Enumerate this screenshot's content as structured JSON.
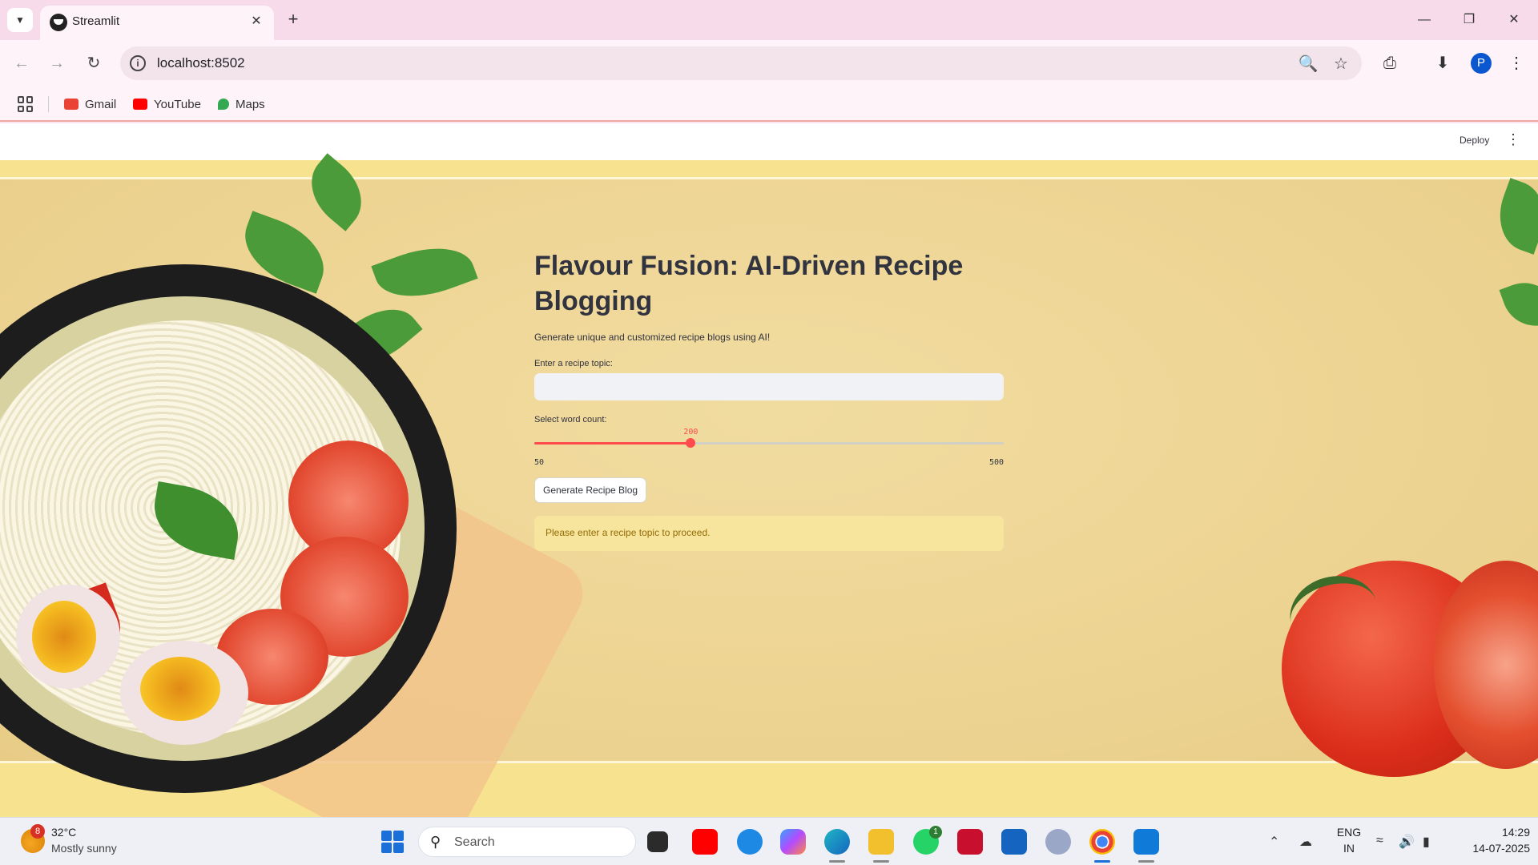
{
  "browser": {
    "tab_title": "Streamlit",
    "url": "localhost:8502",
    "bookmarks": [
      {
        "label": "Gmail",
        "icon": "gmail-icon",
        "color": "#ea4335"
      },
      {
        "label": "YouTube",
        "icon": "youtube-icon",
        "color": "#ff0000"
      },
      {
        "label": "Maps",
        "icon": "maps-icon",
        "color": "#34a853"
      }
    ],
    "profile_initial": "P"
  },
  "app": {
    "deploy_label": "Deploy",
    "title": "Flavour Fusion: AI-Driven Recipe Blogging",
    "subtitle": "Generate unique and customized recipe blogs using AI!",
    "topic_label": "Enter a recipe topic:",
    "topic_value": "",
    "word_count_label": "Select word count:",
    "slider": {
      "min": 50,
      "max": 500,
      "value": 200,
      "min_label": "50",
      "max_label": "500",
      "value_label": "200"
    },
    "generate_button": "Generate Recipe Blog",
    "warning": "Please enter a recipe topic to proceed.",
    "accent_color": "#ff4b4b"
  },
  "taskbar": {
    "weather_temp": "32°C",
    "weather_desc": "Mostly sunny",
    "weather_badge": "8",
    "search_placeholder": "Search",
    "whatsapp_badge": "1",
    "lang_line1": "ENG",
    "lang_line2": "IN",
    "time": "14:29",
    "date": "14-07-2025"
  }
}
